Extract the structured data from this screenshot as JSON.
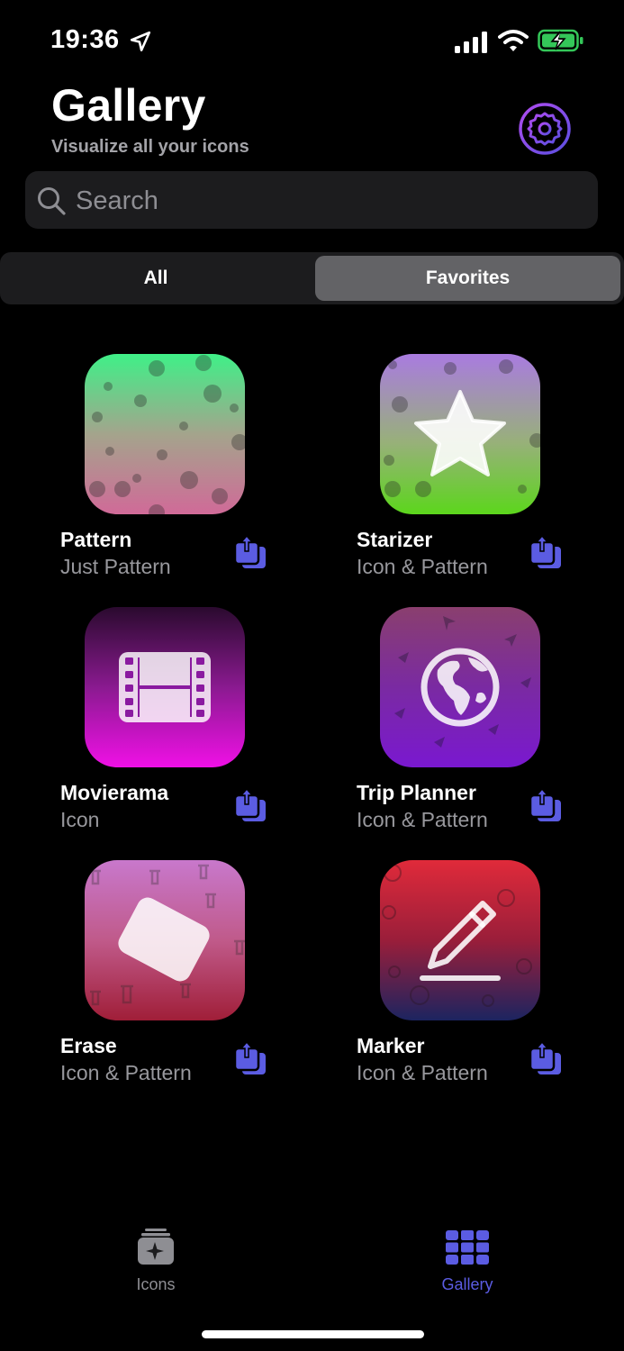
{
  "status_bar": {
    "time": "19:36"
  },
  "header": {
    "title": "Gallery",
    "subtitle": "Visualize all your icons"
  },
  "search": {
    "placeholder": "Search",
    "value": ""
  },
  "segments": [
    {
      "label": "All",
      "selected": false
    },
    {
      "label": "Favorites",
      "selected": true
    }
  ],
  "cards": [
    {
      "name": "Pattern",
      "subtitle": "Just Pattern",
      "icon": "pattern-dots"
    },
    {
      "name": "Starizer",
      "subtitle": "Icon & Pattern",
      "icon": "star"
    },
    {
      "name": "Movierama",
      "subtitle": "Icon",
      "icon": "film"
    },
    {
      "name": "Trip Planner",
      "subtitle": "Icon & Pattern",
      "icon": "globe"
    },
    {
      "name": "Erase",
      "subtitle": "Icon & Pattern",
      "icon": "eraser"
    },
    {
      "name": "Marker",
      "subtitle": "Icon & Pattern",
      "icon": "pencil"
    }
  ],
  "tabbar": {
    "items": [
      {
        "label": "Icons",
        "icon": "icons-stack",
        "active": false
      },
      {
        "label": "Gallery",
        "icon": "grid",
        "active": true
      }
    ]
  },
  "colors": {
    "accent": "#5b5ce2",
    "inactive": "#8e8e93",
    "battery": "#34c759",
    "segment_selected": "#636366"
  }
}
